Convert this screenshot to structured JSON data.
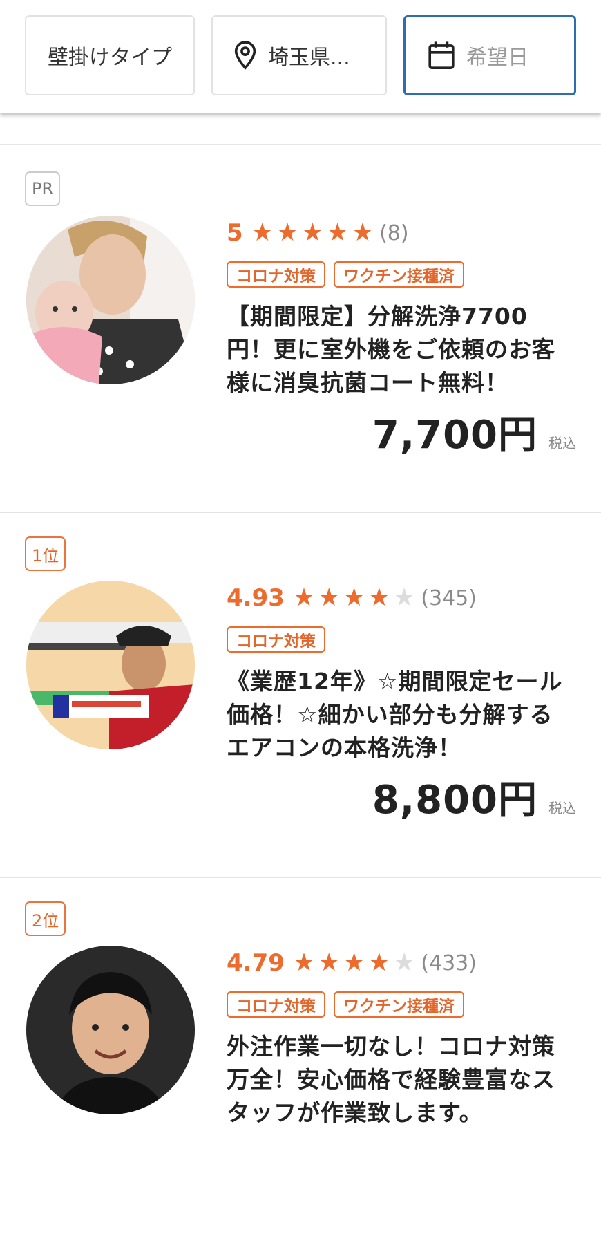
{
  "filters": {
    "type_label": "壁掛けタイプ",
    "location_label": "埼玉県...",
    "date_placeholder": "希望日"
  },
  "colors": {
    "accent": "#ec6b2d",
    "focus_border": "#2d6db0",
    "star_off": "#dcdcdc"
  },
  "listings": [
    {
      "badge": "PR",
      "badge_type": "pr",
      "rating": "5",
      "stars_filled": 5,
      "stars_total": 5,
      "review_count": "(8)",
      "tags": [
        "コロナ対策",
        "ワクチン接種済"
      ],
      "title": "【期間限定】分解洗浄7700円！更に室外機をご依頼のお客様に消臭抗菌コート無料！",
      "price": "7,700円",
      "tax": "税込"
    },
    {
      "badge": "1位",
      "badge_type": "rank",
      "rating": "4.93",
      "stars_filled": 4,
      "stars_total": 5,
      "review_count": "(345)",
      "tags": [
        "コロナ対策"
      ],
      "title": "《業歴12年》☆期間限定セール価格！☆細かい部分も分解するエアコンの本格洗浄！",
      "price": "8,800円",
      "tax": "税込"
    },
    {
      "badge": "2位",
      "badge_type": "rank",
      "rating": "4.79",
      "stars_filled": 4,
      "stars_total": 5,
      "review_count": "(433)",
      "tags": [
        "コロナ対策",
        "ワクチン接種済"
      ],
      "title": "外注作業一切なし！コロナ対策万全！安心価格で経験豊富なスタッフが作業致します。",
      "price": "",
      "tax": ""
    }
  ],
  "icons": {
    "location": "map-pin-icon",
    "date": "calendar-icon",
    "star": "star-icon"
  }
}
